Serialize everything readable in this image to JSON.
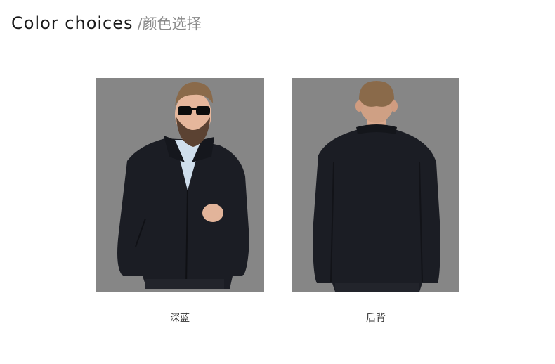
{
  "header": {
    "title_en": "Color choices",
    "title_cn": "/颜色选择"
  },
  "products": [
    {
      "label": "深蓝",
      "view": "front",
      "colors": {
        "background": "#858585",
        "jacket": "#1b1d24",
        "shirt": "#cfe0ee"
      }
    },
    {
      "label": "后背",
      "view": "back",
      "colors": {
        "background": "#858585",
        "jacket": "#1b1d24"
      }
    }
  ]
}
